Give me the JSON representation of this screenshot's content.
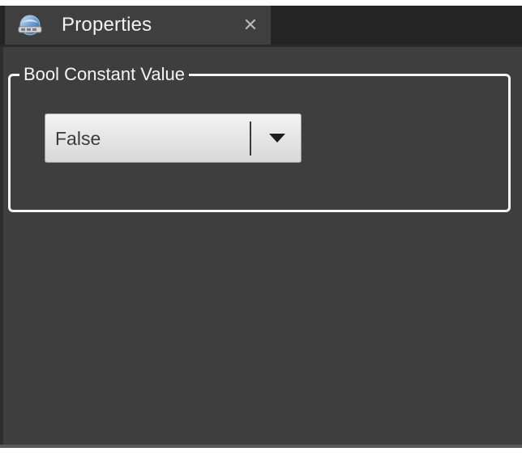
{
  "panel": {
    "tab": {
      "title": "Properties",
      "close_glyph": "✕",
      "icon": "properties-icon"
    }
  },
  "group": {
    "title": "Bool Constant Value",
    "dropdown": {
      "selected": "False",
      "arrow_icon": "caret-down-icon"
    }
  },
  "colors": {
    "tabbar_bg": "#242424",
    "tab_bg": "#3f3f3f",
    "panel_bg": "#3e3e3e",
    "group_border": "#f4f4f4"
  }
}
